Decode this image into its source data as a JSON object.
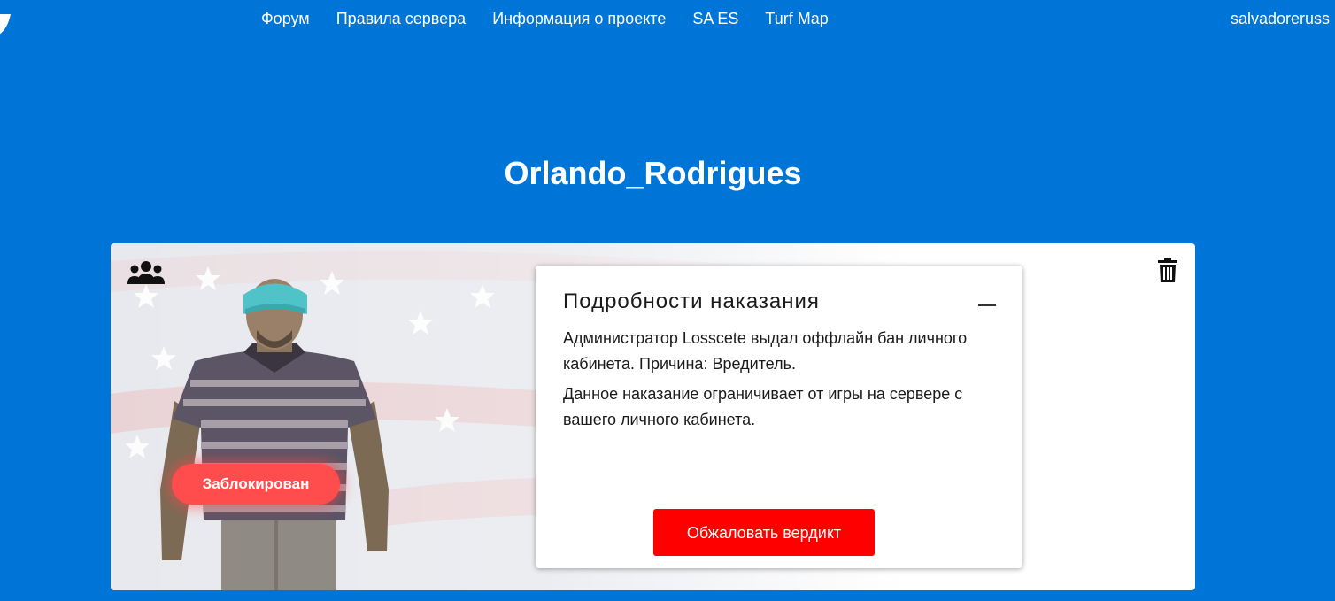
{
  "nav": {
    "items": [
      {
        "label": "Форум"
      },
      {
        "label": "Правила сервера"
      },
      {
        "label": "Информация о проекте"
      },
      {
        "label": "SA ES"
      },
      {
        "label": "Turf Map"
      }
    ],
    "user": "salvadoreruss"
  },
  "profile": {
    "name": "Orlando_Rodrigues",
    "status": "Заблокирован"
  },
  "punishment": {
    "title": "Подробности наказания",
    "text1": "Администратор Losscete выдал оффлайн бан личного кабинета. Причина: Вредитель.",
    "text2": "Данное наказание ограничивает от игры на сервере с вашего личного кабинета.",
    "appeal_label": "Обжаловать вердикт"
  },
  "colors": {
    "background": "#0075d8",
    "badge": "#ff4d4d",
    "appeal": "#ff0000"
  },
  "icons": {
    "group": "users-icon",
    "delete": "trash-icon",
    "collapse": "minus-icon"
  }
}
